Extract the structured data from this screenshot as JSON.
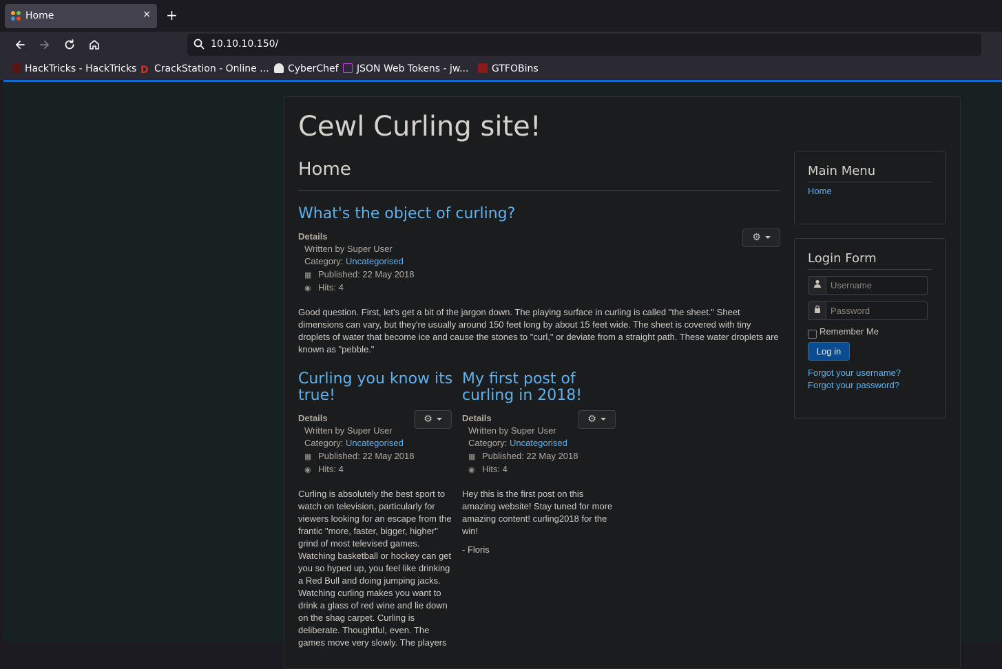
{
  "browser": {
    "tab_title": "Home",
    "url": "10.10.10.150/",
    "bookmarks": [
      {
        "label": "HackTricks - HackTricks",
        "color": "#e34a4a"
      },
      {
        "label": "CrackStation - Online ...",
        "color": "#d0312d"
      },
      {
        "label": "CyberChef",
        "color": "#f0f0f0"
      },
      {
        "label": "JSON Web Tokens - jw...",
        "color": "#d63aff"
      },
      {
        "label": "GTFOBins",
        "color": "#c0272d"
      }
    ]
  },
  "site": {
    "title": "Cewl Curling site!",
    "page_heading": "Home"
  },
  "articles": [
    {
      "title": "What's the object of curling?",
      "details_label": "Details",
      "author": "Written by Super User",
      "category_label": "Category: ",
      "category": "Uncategorised",
      "published": "Published: 22 May 2018",
      "hits": "Hits: 4",
      "body": "Good question. First, let's get a bit of the jargon down. The playing surface in curling is called \"the sheet.\" Sheet dimensions can vary, but they're usually around 150 feet long by about 15 feet wide. The sheet is covered with tiny droplets of water that become ice and cause the stones to \"curl,\" or deviate from a straight path. These water droplets are known as \"pebble.\""
    },
    {
      "title": "Curling you know its true!",
      "details_label": "Details",
      "author": "Written by Super User",
      "category_label": "Category: ",
      "category": "Uncategorised",
      "published": "Published: 22 May 2018",
      "hits": "Hits: 4",
      "body": "Curling is absolutely the best sport to watch on television, particularly for viewers looking for an escape from the frantic \"more, faster, bigger, higher\" grind of most televised games. Watching basketball or hockey can get you so hyped up, you feel like drinking a Red Bull and doing jumping jacks. Watching curling makes you want to drink a glass of red wine and lie down on the shag carpet. Curling is deliberate. Thoughtful, even. The games move very slowly. The players"
    },
    {
      "title": "My first post of curling in 2018!",
      "details_label": "Details",
      "author": "Written by Super User",
      "category_label": "Category: ",
      "category": "Uncategorised",
      "published": "Published: 22 May 2018",
      "hits": "Hits: 4",
      "body": "Hey this is the first post on this amazing website! Stay tuned for more amazing content! curling2018 for the win!",
      "signature": "- Floris"
    }
  ],
  "sidebar": {
    "main_menu_title": "Main Menu",
    "main_menu_items": [
      "Home"
    ],
    "login_title": "Login Form",
    "username_placeholder": "Username",
    "password_placeholder": "Password",
    "remember_label": "Remember Me",
    "login_button": "Log in",
    "forgot_username": "Forgot your username?",
    "forgot_password": "Forgot your password?"
  },
  "icons": {
    "tab_close": "×",
    "new_tab": "+",
    "gear": "⚙"
  }
}
